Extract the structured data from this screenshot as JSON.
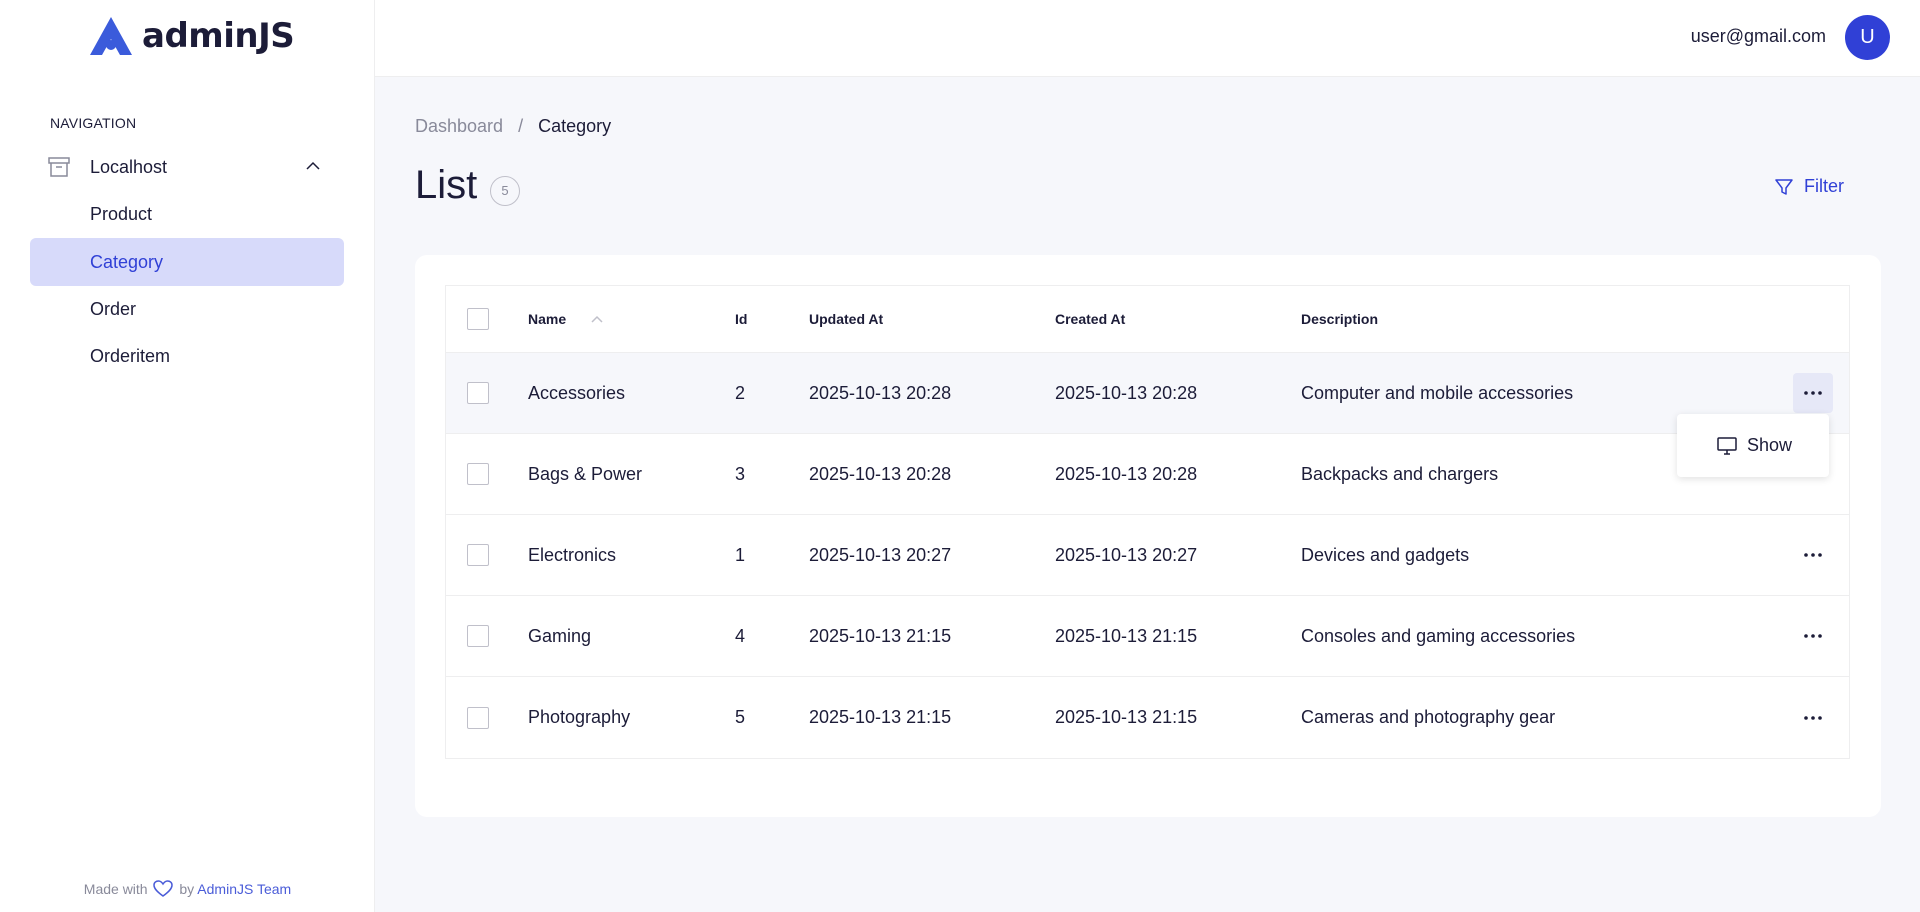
{
  "app": {
    "logo_text": "adminJS"
  },
  "sidebar": {
    "heading": "NAVIGATION",
    "group_label": "Localhost",
    "items": [
      {
        "label": "Product",
        "active": false
      },
      {
        "label": "Category",
        "active": true
      },
      {
        "label": "Order",
        "active": false
      },
      {
        "label": "Orderitem",
        "active": false
      }
    ],
    "footer": {
      "made_with": "Made with",
      "by": "by",
      "team": "AdminJS Team"
    }
  },
  "topbar": {
    "email": "user@gmail.com",
    "avatar_letter": "U"
  },
  "breadcrumb": {
    "root": "Dashboard",
    "separator": "/",
    "current": "Category"
  },
  "page": {
    "title": "List",
    "count": "5",
    "filter_label": "Filter"
  },
  "table": {
    "columns": {
      "name": "Name",
      "id": "Id",
      "updated": "Updated At",
      "created": "Created At",
      "description": "Description"
    },
    "rows": [
      {
        "name": "Accessories",
        "id": "2",
        "updated": "2025-10-13 20:28",
        "created": "2025-10-13 20:28",
        "description": "Computer and mobile accessories"
      },
      {
        "name": "Bags & Power",
        "id": "3",
        "updated": "2025-10-13 20:28",
        "created": "2025-10-13 20:28",
        "description": "Backpacks and chargers"
      },
      {
        "name": "Electronics",
        "id": "1",
        "updated": "2025-10-13 20:27",
        "created": "2025-10-13 20:27",
        "description": "Devices and gadgets"
      },
      {
        "name": "Gaming",
        "id": "4",
        "updated": "2025-10-13 21:15",
        "created": "2025-10-13 21:15",
        "description": "Consoles and gaming accessories"
      },
      {
        "name": "Photography",
        "id": "5",
        "updated": "2025-10-13 21:15",
        "created": "2025-10-13 21:15",
        "description": "Cameras and photography gear"
      }
    ]
  },
  "row_menu": {
    "show_label": "Show"
  },
  "colors": {
    "accent": "#3040d6",
    "active_bg": "#d7dafa",
    "muted": "#898a9a"
  }
}
